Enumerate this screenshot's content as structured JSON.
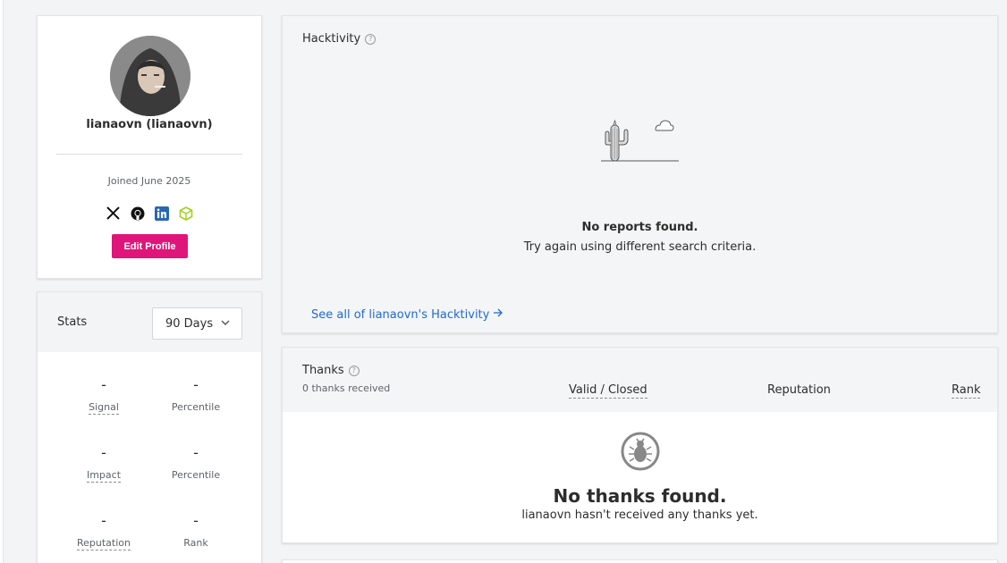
{
  "profile": {
    "display_name": "lianaovn (lianaovn)",
    "joined": "Joined June 2025",
    "socials": [
      "x-icon",
      "github-icon",
      "linkedin-icon",
      "cube-icon"
    ],
    "edit_label": "Edit Profile",
    "colors": {
      "edit_button": "#e0157a",
      "link": "#1f6bd1"
    }
  },
  "stats": {
    "title": "Stats",
    "period": "90 Days",
    "items": [
      {
        "value": "-",
        "label": "Signal"
      },
      {
        "value": "-",
        "label": "Percentile"
      },
      {
        "value": "-",
        "label": "Impact"
      },
      {
        "value": "-",
        "label": "Percentile"
      },
      {
        "value": "-",
        "label": "Reputation"
      },
      {
        "value": "-",
        "label": "Rank"
      }
    ]
  },
  "hacktivity": {
    "title": "Hacktivity",
    "empty_title": "No reports found.",
    "empty_sub": "Try again using different search criteria.",
    "see_all": "See all of lianaovn's Hacktivity"
  },
  "thanks": {
    "title": "Thanks",
    "count": "0 thanks received",
    "columns": [
      "Valid / Closed",
      "Reputation",
      "Rank"
    ],
    "empty_title": "No thanks found.",
    "empty_sub": "lianaovn hasn't received any thanks yet."
  }
}
